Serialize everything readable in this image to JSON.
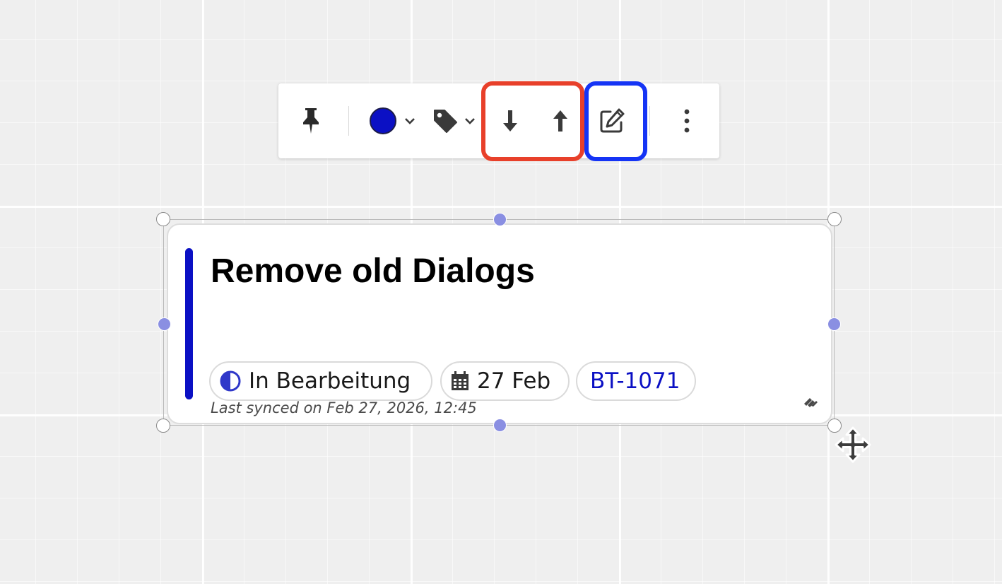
{
  "colors": {
    "accent": "#0b10c4",
    "highlight_red": "#e8402a",
    "highlight_blue": "#1534f5",
    "icon": "#3a3a3a"
  },
  "toolbar": {
    "items": [
      {
        "name": "pin",
        "icon": "pushpin-icon"
      },
      {
        "name": "color",
        "icon": "color-swatch",
        "dropdown": true
      },
      {
        "name": "tag",
        "icon": "tag-icon",
        "dropdown": true
      },
      {
        "name": "send-backward",
        "icon": "arrow-down-icon"
      },
      {
        "name": "bring-forward",
        "icon": "arrow-up-icon"
      },
      {
        "name": "edit",
        "icon": "edit-icon"
      },
      {
        "name": "more",
        "icon": "more-vertical-icon"
      }
    ]
  },
  "card": {
    "title": "Remove old Dialogs",
    "status": "In Bearbeitung",
    "date": "27 Feb",
    "issue_key": "BT-1071",
    "sync_text": "Last synced on Feb 27, 2026, 12:45",
    "status_icon": "half-circle-icon",
    "date_icon": "calendar-icon",
    "source_icon": "jira-icon"
  }
}
